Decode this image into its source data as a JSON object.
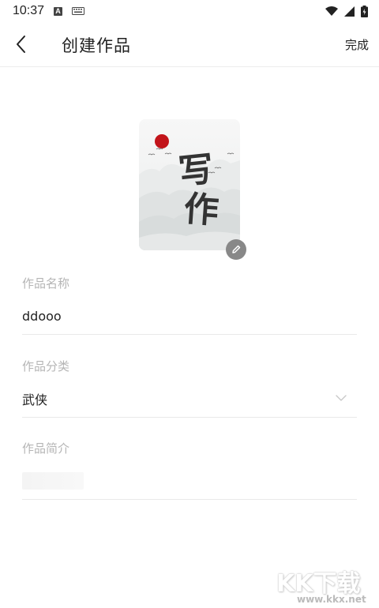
{
  "status_bar": {
    "time": "10:37",
    "icons": [
      "a-icon",
      "keyboard-icon",
      "wifi-icon",
      "signal-icon",
      "battery-icon"
    ]
  },
  "app_bar": {
    "title": "创建作品",
    "done_label": "完成",
    "back_icon": "chevron-left-icon"
  },
  "cover": {
    "title_text": "写作",
    "edit_icon": "pencil-icon",
    "sun_color": "#c2141a"
  },
  "form": {
    "name_label": "作品名称",
    "name_value": "ddooo",
    "category_label": "作品分类",
    "category_value": "武侠",
    "intro_label": "作品简介",
    "intro_value": ""
  },
  "watermark": {
    "logo_text": "KK下载",
    "url": "www.kkx.net"
  }
}
